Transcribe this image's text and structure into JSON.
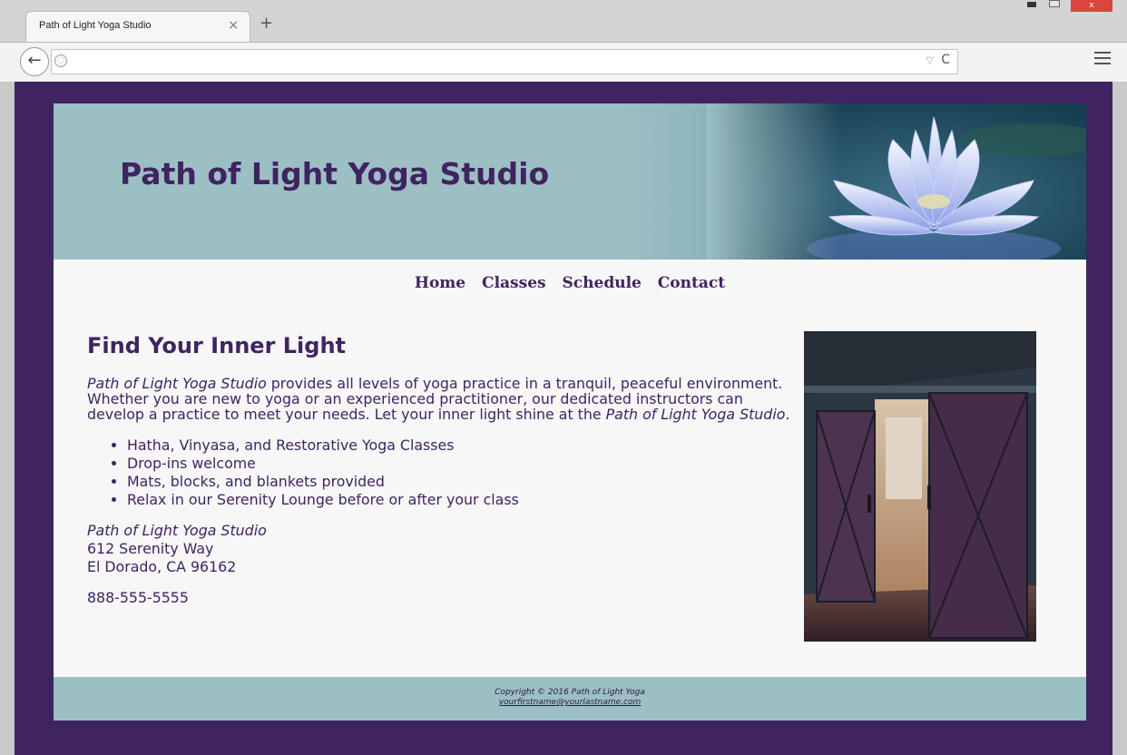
{
  "browser": {
    "tab_title": "Path of Light Yoga Studio",
    "tab_close": "×",
    "new_tab": "+",
    "back": "←",
    "reload": "C",
    "url_dropdown": "▽",
    "window_close": "x"
  },
  "site": {
    "title": "Path of Light Yoga Studio",
    "nav": [
      "Home",
      "Classes",
      "Schedule",
      "Contact"
    ]
  },
  "main": {
    "heading": "Find Your Inner Light",
    "intro": {
      "studio_name_1": "Path of Light Yoga Studio",
      "text_1": " provides all levels of yoga practice in a tranquil, peaceful environment. Whether you are new to yoga or an experienced practitioner, our dedicated instructors can develop a practice to meet your needs. Let your inner light shine at the ",
      "studio_name_2": "Path of Light Yoga Studio",
      "text_2": "."
    },
    "features": [
      "Hatha, Vinyasa, and Restorative Yoga Classes",
      "Drop-ins welcome",
      "Mats, blocks, and blankets provided",
      "Relax in our Serenity Lounge before or after your class"
    ],
    "address": {
      "name": "Path of Light Yoga Studio",
      "street": "612 Serenity Way",
      "city": "El Dorado, CA 96162"
    },
    "phone": "888-555-5555"
  },
  "footer": {
    "copyright": "Copyright © 2016 Path of Light Yoga",
    "email": "yourfirstname@yourlastname.com"
  },
  "colors": {
    "page_bg": "#3f2461",
    "header_bg": "#9cbfc3",
    "text": "#3f2461",
    "content_bg": "#f7f7f7"
  }
}
